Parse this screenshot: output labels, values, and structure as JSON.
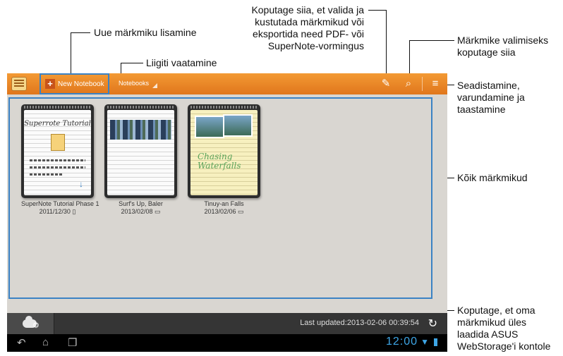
{
  "callouts": {
    "add_notebook": "Uue märkmiku lisamine",
    "view_by_category": "Liigiti vaatamine",
    "select_delete_export": [
      "Koputage siia, et valida ja",
      "kustutada märkmikud või",
      "eksportida need PDF- või",
      "SuperNote-vormingus"
    ],
    "search": [
      "Märkmike valimiseks",
      "koputage siia"
    ],
    "settings": [
      "Seadistamine,",
      "varundamine ja",
      "taastamine"
    ],
    "all_notebooks": "Kõik märkmikud",
    "upload": [
      "Koputage, et oma",
      "märkmikud üles",
      "laadida ASUS",
      "WebStorage'i kontole"
    ]
  },
  "toolbar": {
    "new_notebook_label": "New Notebook",
    "notebooks_label": "Notebooks"
  },
  "notebooks": [
    {
      "name": "SuperNote Tutorial Phase 1",
      "date": "2011/12/30",
      "cover_title": "Superrote Tutorial"
    },
    {
      "name": "Surf's Up, Baler",
      "date": "2013/02/08"
    },
    {
      "name": "Tinuy-an Falls",
      "date": "2013/02/06",
      "cover_title": "Chasing Waterfalls"
    }
  ],
  "status": {
    "last_updated": "Last updated:2013-02-06 00:39:54",
    "clock": "12:00"
  },
  "colors": {
    "toolbar": "#e8851f",
    "highlight": "#3b82c4",
    "accent": "#3ea6e6"
  }
}
